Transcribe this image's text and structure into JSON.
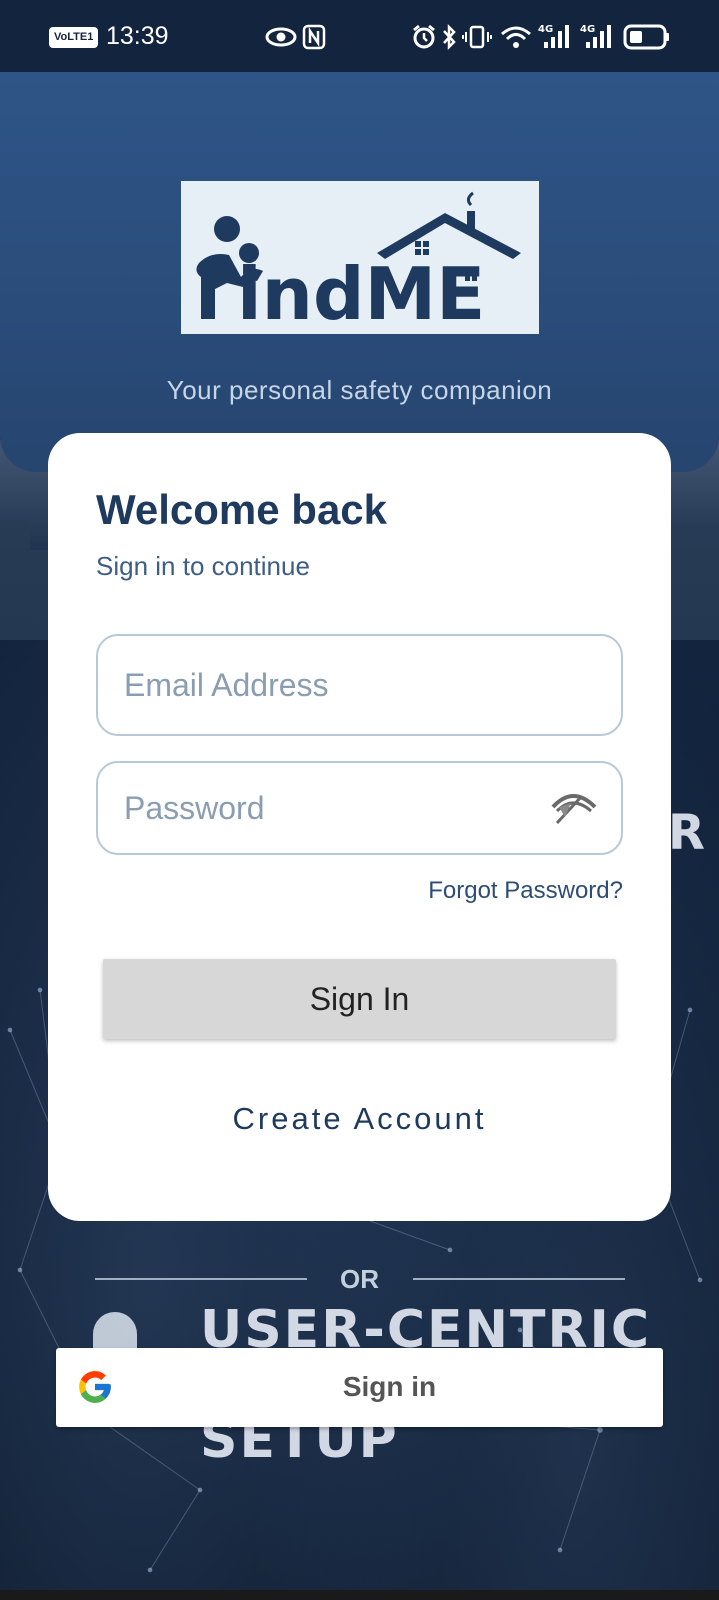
{
  "status_bar": {
    "time": "13:39",
    "volte_label": "VoLTE",
    "sim_number": "1",
    "icons": [
      "eye-icon",
      "nfc-icon",
      "alarm-icon",
      "bluetooth-icon",
      "vibrate-icon",
      "wifi-icon",
      "signal-4g-icon",
      "signal-4g-icon",
      "battery-icon"
    ]
  },
  "header": {
    "logo_text": "findME",
    "tagline": "Your personal safety companion"
  },
  "login_card": {
    "title": "Welcome back",
    "subtitle": "Sign in to continue",
    "email_placeholder": "Email Address",
    "password_placeholder": "Password",
    "forgot_password": "Forgot Password?",
    "sign_in_button": "Sign In",
    "create_account": "Create Account"
  },
  "divider": {
    "label": "OR"
  },
  "google_button": {
    "label": "Sign in"
  },
  "background_text": [
    "USER-CENTRIC",
    "SETUP",
    "R"
  ],
  "colors": {
    "primary": "#1f3a5f",
    "header": "#2e5587",
    "background": "#0e1b30",
    "button": "#d7d7d7"
  }
}
